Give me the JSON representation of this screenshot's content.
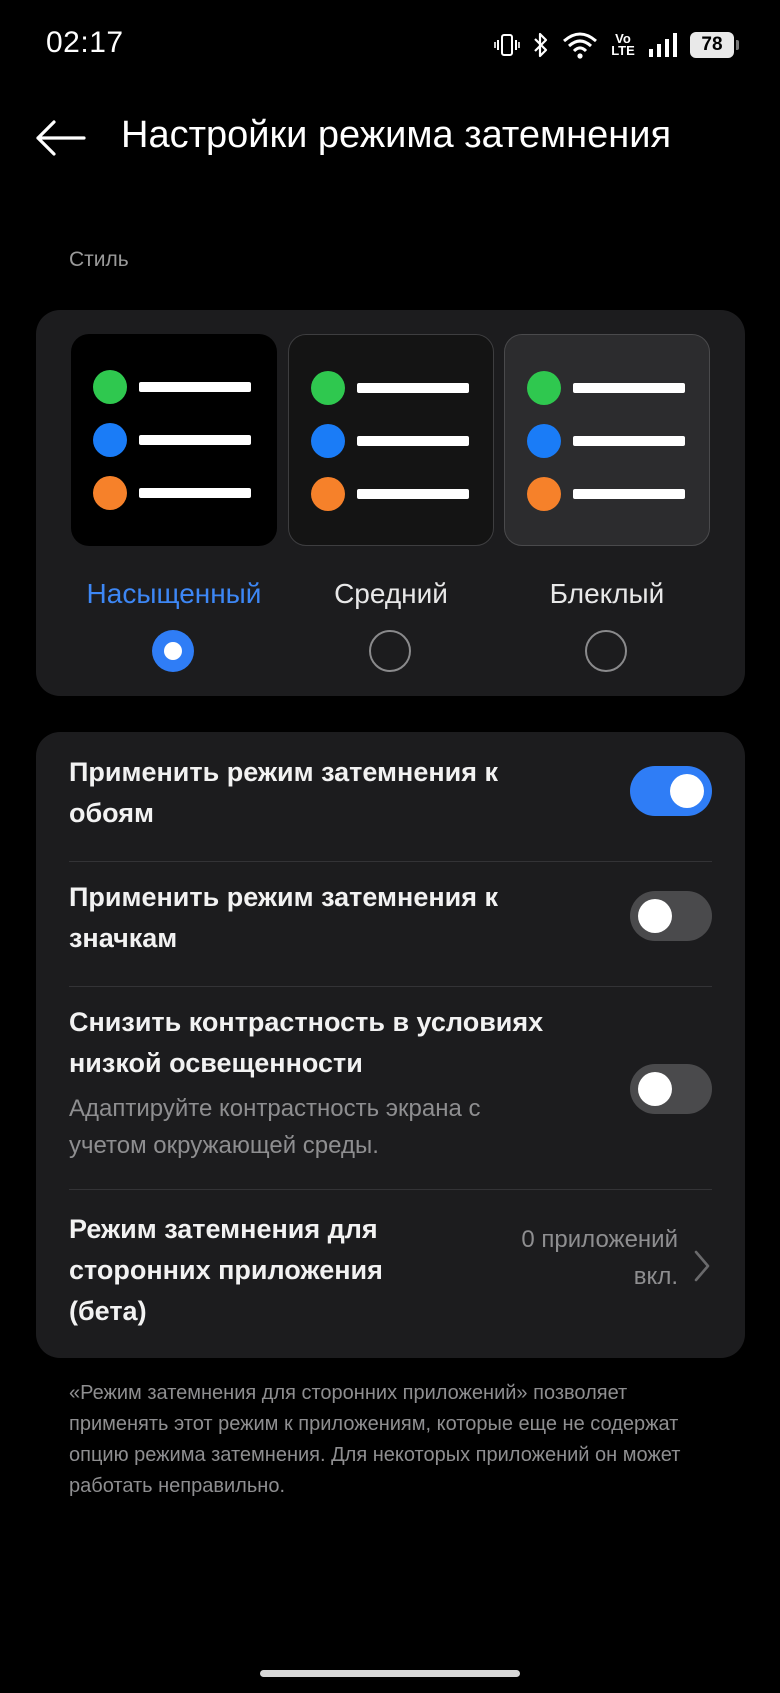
{
  "status_bar": {
    "time": "02:17",
    "volte_top": "Vo",
    "volte_bottom": "LTE",
    "battery": "78",
    "icons": [
      "vibrate-icon",
      "bluetooth-icon",
      "wifi-icon",
      "volte-icon",
      "signal-icon",
      "battery-icon"
    ]
  },
  "header": {
    "back_icon": "back-arrow-icon",
    "title": "Настройки режима затемнения"
  },
  "style_section": {
    "label": "Стиль",
    "options": [
      {
        "label": "Насыщенный",
        "selected": true
      },
      {
        "label": "Средний",
        "selected": false
      },
      {
        "label": "Блеклый",
        "selected": false
      }
    ],
    "dot_colors": [
      "#2fc84f",
      "#1a7cf7",
      "#f6812a"
    ],
    "accent_color": "#2f7df6"
  },
  "settings": [
    {
      "title": "Применить режим затемнения к обоям",
      "toggle_on": true
    },
    {
      "title": "Применить режим затемнения к значкам",
      "toggle_on": false
    },
    {
      "title": "Снизить контрастность в условиях низкой освещенности",
      "description": "Адаптируйте контрастность экрана с учетом окружающей среды.",
      "toggle_on": false
    },
    {
      "title": "Режим затемнения для сторонних приложения (бета)",
      "value": "0 приложений вкл.",
      "icon": "chevron-right-icon"
    }
  ],
  "footer_note": "«Режим затемнения для сторонних приложений» позволяет применять этот режим к приложениям, которые еще не содержат опцию режима затемнения. Для некоторых приложений он может работать неправильно."
}
